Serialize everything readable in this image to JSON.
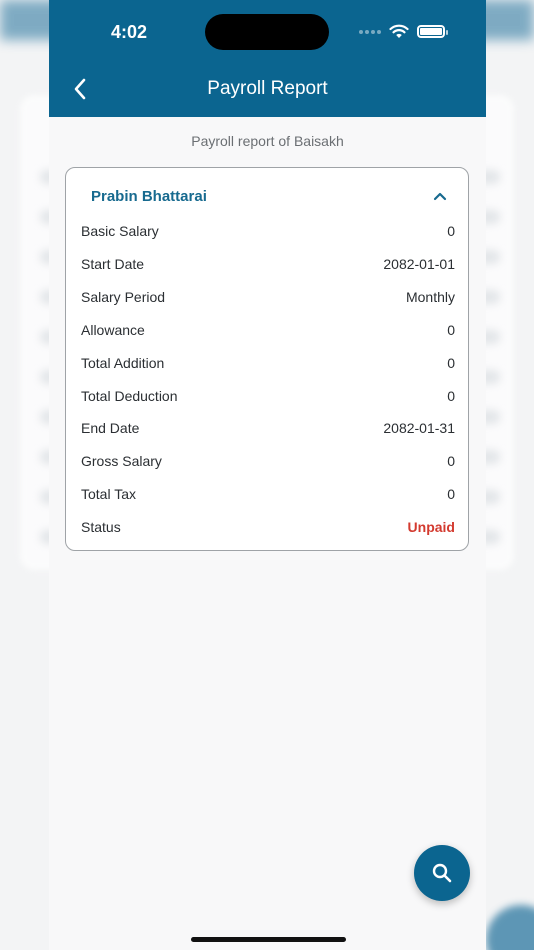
{
  "status_bar": {
    "time": "4:02"
  },
  "header": {
    "title": "Payroll Report"
  },
  "subtitle": "Payroll report of Baisakh",
  "employee": {
    "name": "Prabin  Bhattarai",
    "rows": [
      {
        "label": "Basic Salary",
        "value": "0"
      },
      {
        "label": "Start Date",
        "value": "2082-01-01"
      },
      {
        "label": "Salary Period",
        "value": "Monthly"
      },
      {
        "label": "Allowance",
        "value": "0"
      },
      {
        "label": "Total Addition",
        "value": "0"
      },
      {
        "label": "Total Deduction",
        "value": "0"
      },
      {
        "label": "End Date",
        "value": "2082-01-31"
      },
      {
        "label": "Gross Salary",
        "value": "0"
      },
      {
        "label": "Total Tax",
        "value": "0"
      },
      {
        "label": "Status",
        "value": "Unpaid"
      }
    ]
  },
  "colors": {
    "brand": "#0b6590",
    "unpaid": "#d33a2f",
    "name": "#176a8f"
  },
  "icons": {
    "back": "chevron-left-icon",
    "collapse": "chevron-up-icon",
    "search": "search-icon",
    "wifi": "wifi-icon",
    "battery": "battery-icon"
  }
}
